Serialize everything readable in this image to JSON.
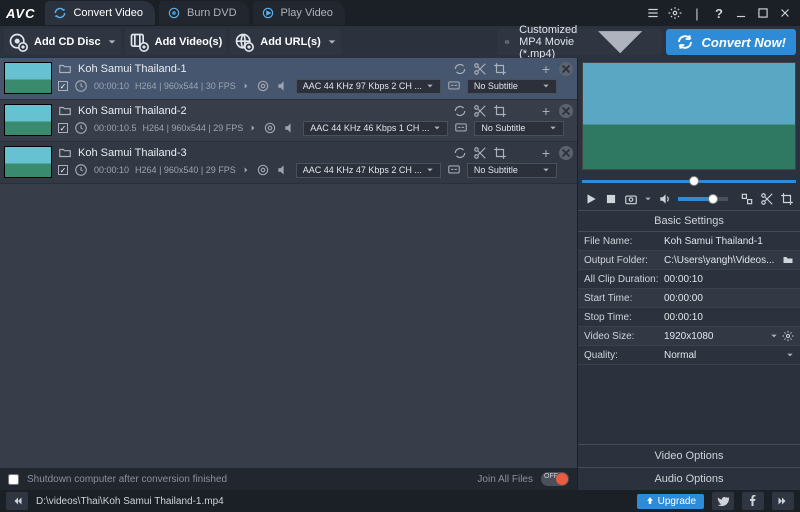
{
  "app": {
    "logo": "AVC"
  },
  "tabs": [
    {
      "label": "Convert Video"
    },
    {
      "label": "Burn DVD"
    },
    {
      "label": "Play Video"
    }
  ],
  "toolbar": {
    "add_disc": "Add CD Disc",
    "add_videos": "Add Video(s)",
    "add_urls": "Add URL(s)",
    "profile": "Customized MP4 Movie (*.mp4)",
    "convert": "Convert Now!"
  },
  "files": [
    {
      "name": "Koh Samui Thailand-1",
      "duration": "00:00:10",
      "meta": "H264  |  960x544  |  30 FPS",
      "audio": "AAC 44 KHz 97 Kbps 2 CH ...",
      "subtitle": "No Subtitle",
      "selected": true
    },
    {
      "name": "Koh Samui Thailand-2",
      "duration": "00:00:10.5",
      "meta": "H264  |  960x544  |  29 FPS",
      "audio": "AAC 44 KHz 46 Kbps 1 CH ...",
      "subtitle": "No Subtitle",
      "selected": false
    },
    {
      "name": "Koh Samui Thailand-3",
      "duration": "00:00:10",
      "meta": "H264  |  960x540  |  29 FPS",
      "audio": "AAC 44 KHz 47 Kbps 2 CH ...",
      "subtitle": "No Subtitle",
      "selected": false
    }
  ],
  "bottom": {
    "shutdown_label": "Shutdown computer after conversion finished",
    "join_label": "Join All Files",
    "toggle_text": "OFF"
  },
  "path": "D:\\videos\\Thai\\Koh Samui Thailand-1.mp4",
  "upgrade_label": "Upgrade",
  "settings": {
    "header": "Basic Settings",
    "file_name_k": "File Name:",
    "file_name_v": "Koh Samui Thailand-1",
    "output_k": "Output Folder:",
    "output_v": "C:\\Users\\yangh\\Videos...",
    "dur_k": "All Clip Duration:",
    "dur_v": "00:00:10",
    "start_k": "Start Time:",
    "start_v": "00:00:00",
    "stop_k": "Stop Time:",
    "stop_v": "00:00:10",
    "size_k": "Video Size:",
    "size_v": "1920x1080",
    "quality_k": "Quality:",
    "quality_v": "Normal",
    "video_opts": "Video Options",
    "audio_opts": "Audio Options"
  }
}
